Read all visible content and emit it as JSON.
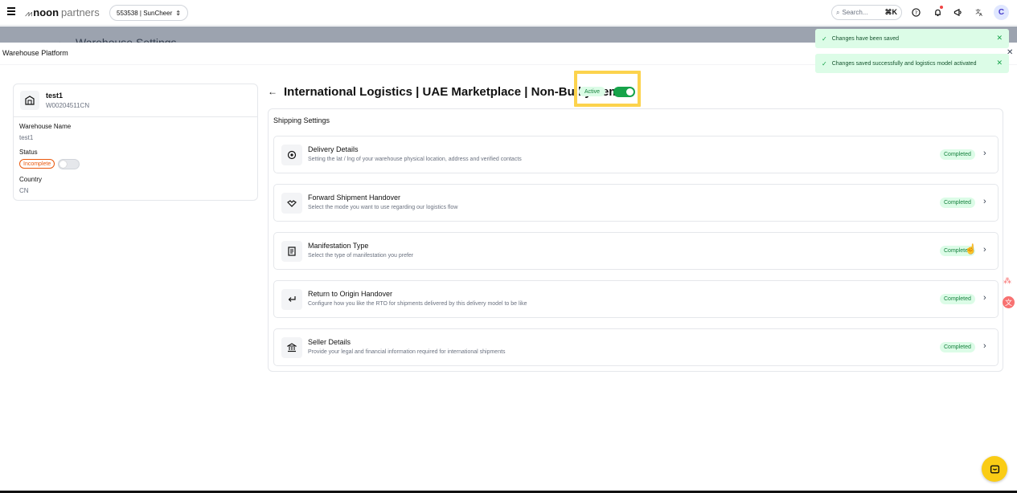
{
  "topbar": {
    "brand_bold": "noon",
    "brand_light": "partners",
    "account": "553538 | SunCheer",
    "search_placeholder": "Search...",
    "search_shortcut": "⌘K",
    "avatar_initial": "C"
  },
  "background": {
    "title": "Warehouse Settings"
  },
  "panel": {
    "title": "Warehouse Platform"
  },
  "warehouse": {
    "name": "test1",
    "code": "W00204511CN",
    "name_label": "Warehouse Name",
    "name_value": "test1",
    "status_label": "Status",
    "status_badge": "Incomplete",
    "country_label": "Country",
    "country_value": "CN"
  },
  "model": {
    "title": "International Logistics | UAE Marketplace | Non-Bulky Items",
    "status": "Active",
    "enabled": true
  },
  "shipping": {
    "title": "Shipping Settings",
    "rows": [
      {
        "title": "Delivery Details",
        "desc": "Setting the lat / lng of your warehouse physical location, address and verified contacts",
        "status": "Completed",
        "icon": "location-pin-icon"
      },
      {
        "title": "Forward Shipment Handover",
        "desc": "Select the mode you want to use regarding our logistics flow",
        "status": "Completed",
        "icon": "handshake-icon"
      },
      {
        "title": "Manifestation Type",
        "desc": "Select the type of manifestation you prefer",
        "status": "Completed",
        "icon": "document-icon"
      },
      {
        "title": "Return to Origin Handover",
        "desc": "Configure how you like the RTO for shipments delivered by this delivery model to be like",
        "status": "Completed",
        "icon": "return-arrow-icon"
      },
      {
        "title": "Seller Details",
        "desc": "Provide your legal and financial information required for international shipments",
        "status": "Completed",
        "icon": "bank-icon"
      }
    ]
  },
  "toasts": [
    {
      "message": "Changes have been saved"
    },
    {
      "message": "Changes saved successfully and logistics model activated"
    }
  ],
  "colors": {
    "accent_green": "#16a34a",
    "highlight_yellow": "#fcd34d",
    "incomplete_orange": "#ea580c"
  }
}
